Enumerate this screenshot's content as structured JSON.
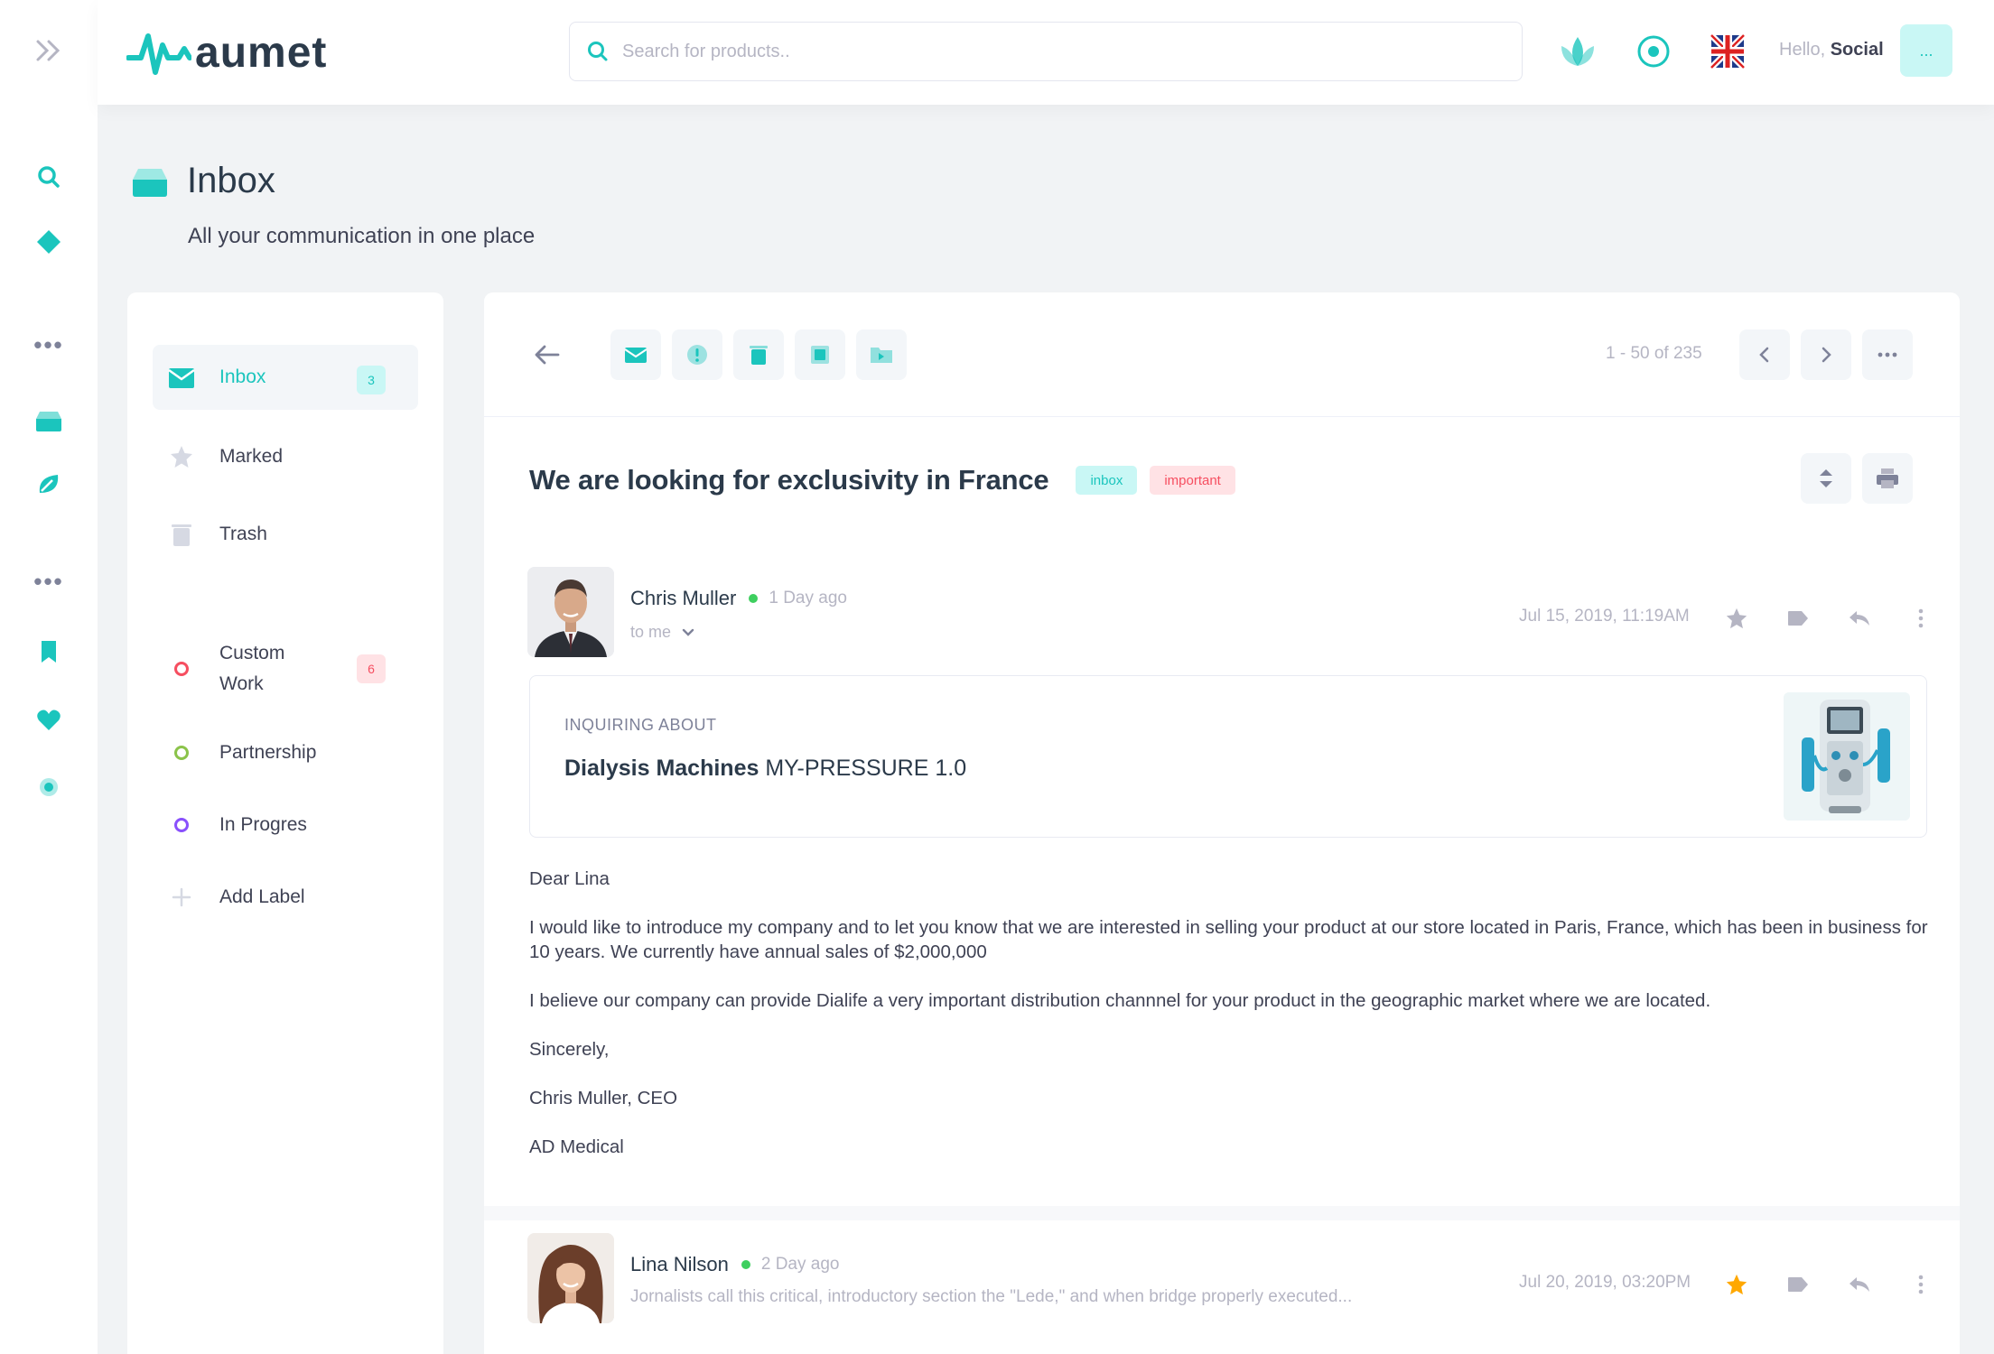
{
  "app": {
    "logo_text": "aumet"
  },
  "search": {
    "placeholder": "Search for products.."
  },
  "header": {
    "greeting": "Hello,",
    "user_name": "Social",
    "avatar_text": "..."
  },
  "page": {
    "title": "Inbox",
    "subtitle": "All your communication in one place"
  },
  "folders": [
    {
      "label": "Inbox",
      "count": "3",
      "icon": "envelope-icon"
    },
    {
      "label": "Marked",
      "icon": "star-icon"
    },
    {
      "label": "Trash",
      "icon": "trash-icon"
    }
  ],
  "labels": [
    {
      "label": "Custom Work",
      "count": "6",
      "color": "#f64e60"
    },
    {
      "label": "Partnership",
      "color": "#8bc34a"
    },
    {
      "label": "In Progres",
      "color": "#8950fc"
    },
    {
      "label": "Add Label",
      "icon": "plus-icon"
    }
  ],
  "toolbar": {
    "pager": "1 - 50 of 235"
  },
  "message": {
    "subject": "We are looking for exclusivity in France",
    "tags": [
      "inbox",
      "important"
    ],
    "sender": {
      "name": "Chris Muller",
      "ago": "1 Day ago",
      "to": "to me",
      "date": "Jul 15, 2019, 11:19AM"
    },
    "inquiry": {
      "label": "INQUIRING ABOUT",
      "product_bold": "Dialysis Machines",
      "product_model": "MY-PRESSURE 1.0"
    },
    "body": [
      "Dear Lina",
      "I would like to introduce my company and to let you know that we are interested in selling your product at our store located in Paris, France, which has been in business for 10 years. We currently have annual sales of $2,000,000",
      "I believe our company can provide Dialife a very important distribution channnel for your product in the geographic market where we are located.",
      "Sincerely,",
      "Chris Muller, CEO",
      "AD Medical"
    ]
  },
  "reply": {
    "name": "Lina Nilson",
    "ago": "2 Day ago",
    "snippet": "Jornalists call this critical, introductory section the \"Lede,\" and when bridge properly executed...",
    "date": "Jul 20, 2019, 03:20PM"
  },
  "colors": {
    "accent": "#1bc5bd",
    "danger": "#f64e60",
    "star": "#ffa800"
  }
}
